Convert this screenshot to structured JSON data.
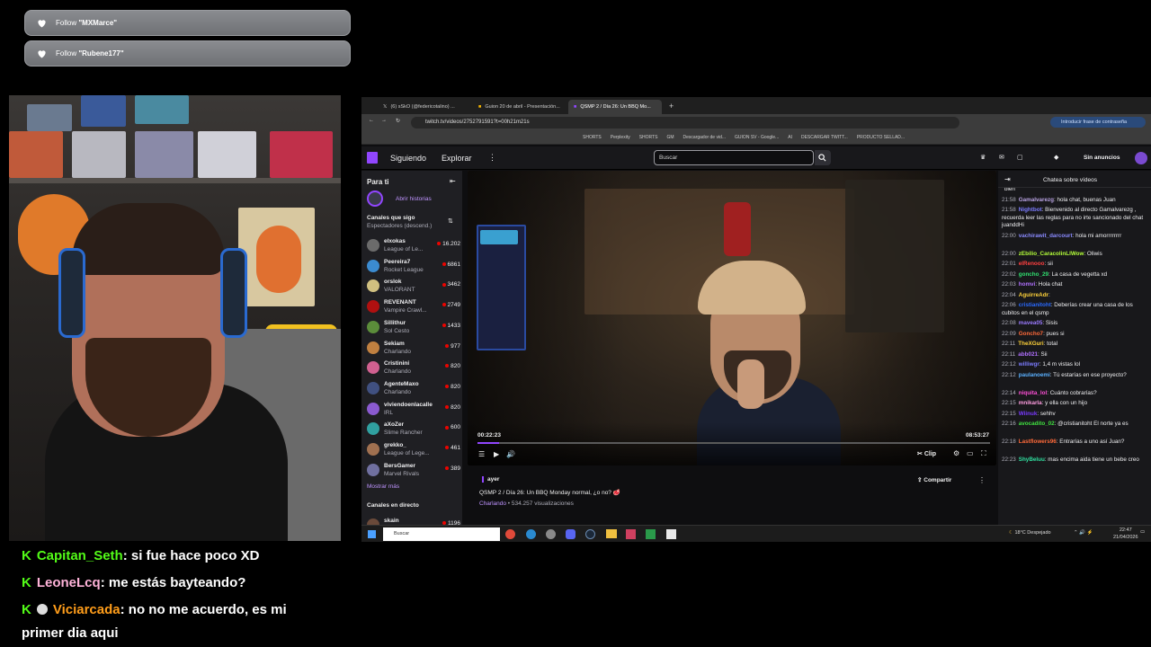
{
  "follow_alerts": [
    {
      "prefix": "Follow ",
      "user": "\"MXMarce\""
    },
    {
      "prefix": "Follow ",
      "user": "\"Rubene177\""
    }
  ],
  "overlay_chat": [
    {
      "user": "Capitan_Seth",
      "user_color": "#53fc18",
      "text": ": si fue hace poco XD"
    },
    {
      "user": "LeoneLcq",
      "user_color": "#ffb3d9",
      "text": ": me estás bayteando?"
    },
    {
      "user": "Viciarcada",
      "user_color": "#ff9d1a",
      "text": ": no no me acuerdo, es mi",
      "text2": "primer dia aqui"
    }
  ],
  "browser": {
    "tabs": [
      "(6) sSkO (@federicotalino) ...",
      "Guion 20 de abril - Presentación...",
      "QSMP 2 / Día 26: Un BBQ Mo..."
    ],
    "url": "twitch.tv/videos/2752791591?t=00h21m21s",
    "profile_button": "Introducir frase de contraseña",
    "bookmarks": [
      "SHORTS",
      "Perplexity",
      "SHORTS",
      "GM",
      "Descargador de vid...",
      "GUION SV - Google...",
      "AI",
      "DESCARGAR TWITT...",
      "PRODUCTO SELLAD..."
    ]
  },
  "twitch": {
    "nav_following": "Siguiendo",
    "nav_explore": "Explorar",
    "search_placeholder": "Buscar",
    "no_ads": "Sin anuncios",
    "sidebar_title": "Para ti",
    "open_stories": "Abrir historias",
    "followed_header": "Canales que sigo",
    "followed_sub": "Espectadores (descend.)",
    "channels": [
      {
        "name": "elxokas",
        "game": "League of Le...",
        "viewers": "16.202",
        "color": "#6b6b6b"
      },
      {
        "name": "Peereira7",
        "game": "Rocket League",
        "viewers": "6861",
        "color": "#3b8bd0"
      },
      {
        "name": "orslok",
        "game": "VALORANT",
        "viewers": "3462",
        "color": "#d0c080"
      },
      {
        "name": "REVENANT",
        "game": "Vampire Crawl...",
        "viewers": "2749",
        "color": "#b01010"
      },
      {
        "name": "Sillithur",
        "game": "Sol Cesto",
        "viewers": "1433",
        "color": "#5b8c3a"
      },
      {
        "name": "Sekiam",
        "game": "Charlando",
        "viewers": "977",
        "color": "#c08040"
      },
      {
        "name": "Cristinini",
        "game": "Charlando",
        "viewers": "820",
        "color": "#d06090"
      },
      {
        "name": "AgenteMaxo",
        "game": "Charlando",
        "viewers": "820",
        "color": "#405080"
      },
      {
        "name": "viviendoenlacalle",
        "game": "IRL",
        "viewers": "820",
        "color": "#8a5ad0"
      },
      {
        "name": "aXoZer",
        "game": "Slime Rancher",
        "viewers": "600",
        "color": "#30a0a0"
      },
      {
        "name": "grekko_",
        "game": "League of Lege...",
        "viewers": "461",
        "color": "#a07050"
      },
      {
        "name": "BersGamer",
        "game": "Marvel Rivals",
        "viewers": "389",
        "color": "#7070a0"
      }
    ],
    "show_more": "Mostrar más",
    "live_header": "Canales en directo",
    "live_first": {
      "name": "skain",
      "viewers": "1196"
    },
    "video": {
      "time_current": "00:22:23",
      "time_total": "08:53:27",
      "progress": 0.042,
      "clip": "Clip"
    },
    "info": {
      "date": "ayer",
      "title": "QSMP 2 / Día 26: Un BBQ Monday normal, ¿o no? 🥩",
      "category": "Charlando",
      "views": " • 534.257 visualizaciones",
      "share": "Compartir"
    },
    "chat_title": "Chatea sobre vídeos",
    "chat": [
      {
        "t": "",
        "u": "",
        "c": "#bf94ff",
        "m": "bien"
      },
      {
        "t": "21:58",
        "u": "Gamalvarezg",
        "c": "#b9a3e3",
        "m": ": hola chat, buenas Juan"
      },
      {
        "t": "21:58",
        "u": "Nightbot",
        "c": "#7c7cff",
        "m": ": Bienvenido al directo Gamalvarezg , recuerda leer las reglas para no irte sancionado del chat juanddHi"
      },
      {
        "t": "22:00",
        "u": "vachirawit_darcourt",
        "c": "#8a8aff",
        "m": ": hola mi amorrrrrrrr"
      },
      {
        "t": "22:00",
        "u": "zEbilio_CaracolinLIWow",
        "c": "#b4ff3a",
        "m": ": Oliwis"
      },
      {
        "t": "22:01",
        "u": "elRenooo",
        "c": "#ff4040",
        "m": ": sii"
      },
      {
        "t": "22:02",
        "u": "goncho_29",
        "c": "#30e070",
        "m": ": La casa de vegetta xd"
      },
      {
        "t": "22:03",
        "u": "homvi",
        "c": "#b070ff",
        "m": ": Hola chat"
      },
      {
        "t": "22:04",
        "u": "AguirreAdr",
        "c": "#ffd23a",
        "m": ":"
      },
      {
        "t": "22:06",
        "u": "cristianitoht",
        "c": "#2a6aff",
        "m": ": Deberías crear una casa de los cubitos en el qsmp"
      },
      {
        "t": "22:08",
        "u": "mavea05",
        "c": "#9a7aff",
        "m": ": Sisis"
      },
      {
        "t": "22:09",
        "u": "Goncho7",
        "c": "#ff6a3a",
        "m": ": pues si"
      },
      {
        "t": "22:11",
        "u": "TheXGuri",
        "c": "#ffd23a",
        "m": ": total"
      },
      {
        "t": "22:11",
        "u": "abb021",
        "c": "#b070ff",
        "m": ": Sii"
      },
      {
        "t": "22:12",
        "u": "williwgr",
        "c": "#7c7cff",
        "m": ": 1,4 m vistas lol"
      },
      {
        "t": "22:12",
        "u": "paulanoemi",
        "c": "#5ab0ff",
        "m": ": Tú estarías en ese proyecto?"
      },
      {
        "t": "22:14",
        "u": "niquita_lol",
        "c": "#ff4fd8",
        "m": ": Cuánto cobrarías?"
      },
      {
        "t": "22:15",
        "u": "mnikarla",
        "c": "#ff9de0",
        "m": ": y ella con un hijo"
      },
      {
        "t": "22:15",
        "u": "Wiinuk",
        "c": "#7a3aff",
        "m": ": sehhv"
      },
      {
        "t": "22:16",
        "u": "avocadito_02",
        "c": "#40e040",
        "m": ": @cristianitoht El norte ya es"
      },
      {
        "t": "22:18",
        "u": "Lastflowers96",
        "c": "#ff6a3a",
        "m": ": Entrarías a uno así Juan?"
      },
      {
        "t": "22:23",
        "u": "ShyBeluu",
        "c": "#30e0a0",
        "m": ": mas encima aida tiene un bebe creo"
      }
    ]
  },
  "taskbar": {
    "search": "Buscar",
    "weather": "18°C  Despejado",
    "time": "22:47",
    "date": "21/04/2026"
  }
}
